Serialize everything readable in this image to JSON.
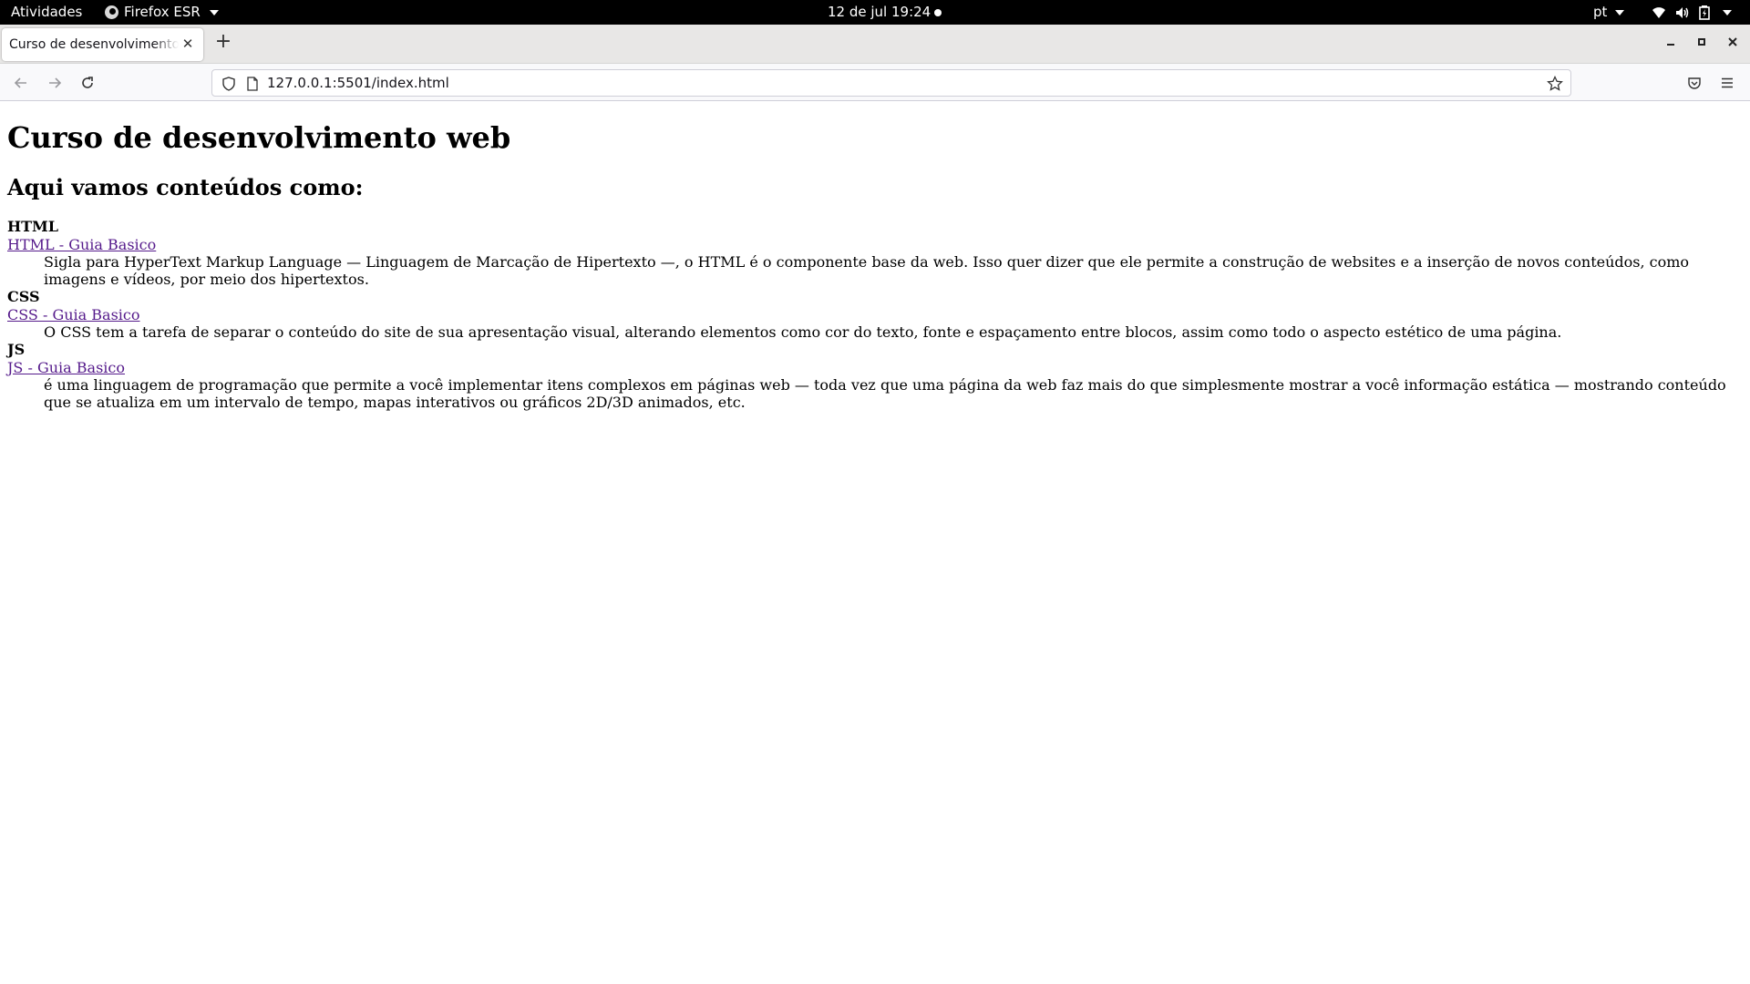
{
  "system_bar": {
    "activities": "Atividades",
    "app_name": "Firefox ESR",
    "clock": "12 de jul  19:24",
    "language": "pt",
    "icons": [
      "wifi-icon",
      "volume-icon",
      "battery-icon",
      "system-menu-caret-icon"
    ]
  },
  "browser": {
    "tab": {
      "title": "Curso de desenvolvimento web"
    },
    "url": "127.0.0.1:5501/index.html",
    "icons": [
      "back-icon",
      "forward-icon",
      "reload-icon",
      "shield-icon",
      "page-icon",
      "bookmark-star-icon",
      "pocket-icon",
      "menu-icon"
    ]
  },
  "page": {
    "title": "Curso de desenvolvimento web",
    "subtitle": "Aqui vamos conteúdos como:",
    "topics": [
      {
        "term": "HTML",
        "link": "HTML - Guia Basico",
        "description": "Sigla para HyperText Markup Language — Linguagem de Marcação de Hipertexto —, o HTML é o componente base da web. Isso quer dizer que ele permite a construção de websites e a inserção de novos conteúdos, como imagens e vídeos, por meio dos hipertextos."
      },
      {
        "term": "CSS",
        "link": "CSS - Guia Basico",
        "description": "O CSS tem a tarefa de separar o conteúdo do site de sua apresentação visual, alterando elementos como cor do texto, fonte e espaçamento entre blocos, assim como todo o aspecto estético de uma página."
      },
      {
        "term": "JS",
        "link": "JS - Guia Basico",
        "description": "é uma linguagem de programação que permite a você implementar itens complexos em páginas web — toda vez que uma página da web faz mais do que simplesmente mostrar a você informação estática — mostrando conteúdo que se atualiza em um intervalo de tempo, mapas interativos ou gráficos 2D/3D animados, etc."
      }
    ]
  },
  "colors": {
    "visited_link": "#551a8b",
    "system_bar": "#000000",
    "tab_strip": "#e8e7e6"
  }
}
